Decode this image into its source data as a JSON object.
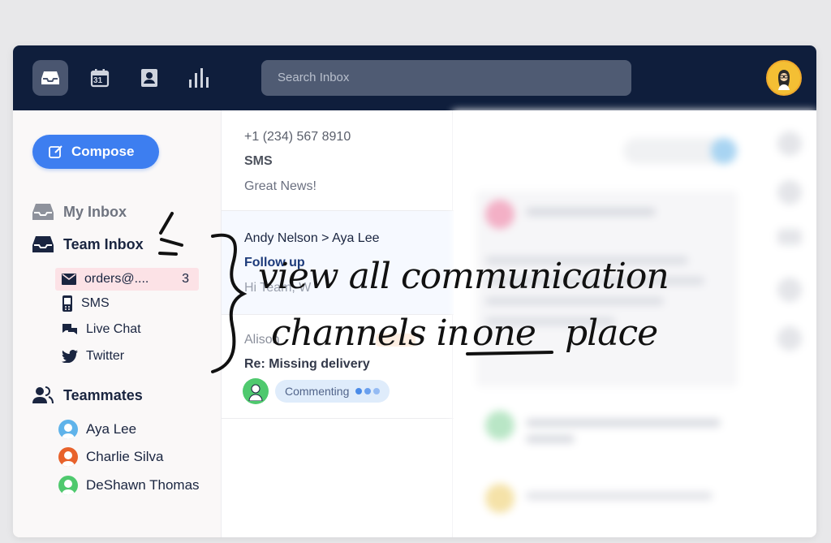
{
  "topbar": {
    "nav_icons": [
      "inbox-icon",
      "calendar-icon",
      "contacts-icon",
      "analytics-icon"
    ],
    "calendar_day": "31",
    "search_placeholder": "Search Inbox"
  },
  "sidebar": {
    "compose_label": "Compose",
    "my_inbox": "My Inbox",
    "team_inbox": "Team Inbox",
    "channels": [
      {
        "label": "orders@....",
        "count": "3",
        "icon": "mail-icon"
      },
      {
        "label": "SMS",
        "icon": "phone-icon"
      },
      {
        "label": "Live Chat",
        "icon": "chat-icon"
      },
      {
        "label": "Twitter",
        "icon": "twitter-icon"
      }
    ],
    "teammates_title": "Teammates",
    "teammates": [
      {
        "name": "Aya Lee",
        "color": "#5fb3ea"
      },
      {
        "name": "Charlie Silva",
        "color": "#e8622b"
      },
      {
        "name": "DeShawn Thomas",
        "color": "#4fc96e"
      }
    ]
  },
  "messages": [
    {
      "from": "+1 (234) 567 8910",
      "channel": "SMS",
      "preview": "Great News!"
    },
    {
      "from": "Andy Nelson > Aya Lee",
      "subject": "Follow up",
      "preview": "Hi Team, W"
    },
    {
      "from": "Alison",
      "subject": "Re: Missing delivery",
      "status": "Commenting"
    }
  ],
  "annotation": {
    "line1": "view all communication",
    "line2_a": "channels in",
    "line2_b": "one",
    "line2_c": "place"
  },
  "colors": {
    "topbar": "#0f1e3c",
    "compose": "#3d7ef0",
    "selected_channel": "#fce2e6"
  }
}
